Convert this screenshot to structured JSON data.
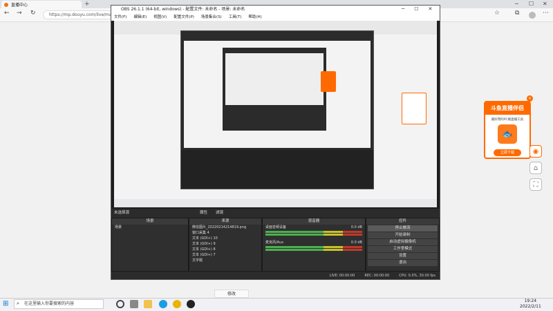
{
  "browser": {
    "tab_title": "直播中心",
    "url": "https://mp.douyu.com/live/main",
    "new_tab": "+"
  },
  "obs": {
    "title": "OBS 26.1.1 (64-bit, windows) - 配置文件: 未命名 - 场景: 未命名",
    "menu": [
      "文件(F)",
      "编辑(E)",
      "视图(V)",
      "配置文件(P)",
      "场景集合(S)",
      "工具(T)",
      "帮助(H)"
    ],
    "no_source": "未选择源",
    "props": "属性",
    "filters": "滤镜",
    "panels": {
      "scenes": "场景",
      "sources": "来源",
      "mixer": "混音器",
      "controls": "控件"
    },
    "scene_item": "场景",
    "sources": [
      "微信图片_20220214214819.png",
      "窗口采集 4",
      "文本 (GDI+) 10",
      "文本 (GDI+) 9",
      "文本 (GDI+) 8",
      "文本 (GDI+) 7",
      "文字题"
    ],
    "mixer": [
      {
        "name": "桌面音频设备",
        "db": "0.0 dB"
      },
      {
        "name": "麦克风/Aux",
        "db": "0.0 dB"
      }
    ],
    "controls": [
      "停止推流",
      "开始录制",
      "启动虚拟摄像机",
      "工作室模式",
      "设置",
      "退出"
    ],
    "control_tabs": [
      "控件",
      "场景转换"
    ],
    "status": [
      "LIVE: 00:00:00",
      "REC: 00:00:00",
      "CPU: 0.0%, 30.00 fps"
    ]
  },
  "ad": {
    "title": "斗鱼直播伴侣",
    "desc": "最好用的PC端直播工具",
    "button": "立即下载",
    "close": "×"
  },
  "page": {
    "bottom_button": "修改"
  },
  "taskbar": {
    "search_placeholder": "在这里输入你要搜索的内容",
    "time": "19:24",
    "date": "2022/2/11"
  }
}
